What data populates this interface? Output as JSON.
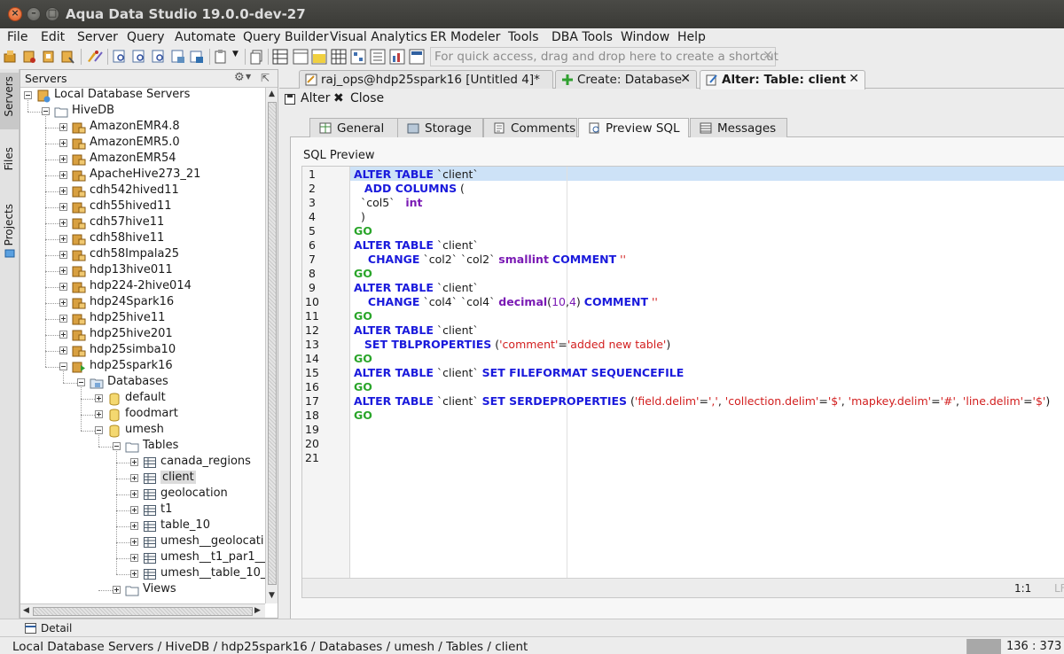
{
  "window": {
    "title": "Aqua Data Studio 19.0.0-dev-27"
  },
  "menu": [
    "File",
    "Edit",
    "Server",
    "Query",
    "Automate",
    "Query Builder",
    "Visual Analytics",
    "ER Modeler",
    "Tools",
    "DBA Tools",
    "Window",
    "Help"
  ],
  "toolbar": {
    "quick_access_placeholder": "For quick access, drag and drop here to create a shortcut"
  },
  "side_tabs": [
    "Servers",
    "Files",
    "Projects"
  ],
  "servers_panel": {
    "title": "Servers",
    "tree": [
      {
        "label": "Local Database Servers",
        "level": 0,
        "icon": "server-group-icon",
        "expander": "minus"
      },
      {
        "label": "HiveDB",
        "level": 1,
        "icon": "folder-icon",
        "expander": "minus"
      },
      {
        "label": "AmazonEMR4.8",
        "level": 2,
        "icon": "database-server-icon",
        "expander": "plus"
      },
      {
        "label": "AmazonEMR5.0",
        "level": 2,
        "icon": "database-server-icon",
        "expander": "plus"
      },
      {
        "label": "AmazonEMR54",
        "level": 2,
        "icon": "database-server-icon",
        "expander": "plus"
      },
      {
        "label": "ApacheHive273_21",
        "level": 2,
        "icon": "database-server-icon",
        "expander": "plus"
      },
      {
        "label": "cdh542hived11",
        "level": 2,
        "icon": "database-server-icon",
        "expander": "plus"
      },
      {
        "label": "cdh55hived11",
        "level": 2,
        "icon": "database-server-icon",
        "expander": "plus"
      },
      {
        "label": "cdh57hive11",
        "level": 2,
        "icon": "database-server-icon",
        "expander": "plus"
      },
      {
        "label": "cdh58hive11",
        "level": 2,
        "icon": "database-server-icon",
        "expander": "plus"
      },
      {
        "label": "cdh58Impala25",
        "level": 2,
        "icon": "database-server-icon",
        "expander": "plus"
      },
      {
        "label": "hdp13hive011",
        "level": 2,
        "icon": "database-server-icon",
        "expander": "plus"
      },
      {
        "label": "hdp224-2hive014",
        "level": 2,
        "icon": "database-server-icon",
        "expander": "plus"
      },
      {
        "label": "hdp24Spark16",
        "level": 2,
        "icon": "database-server-icon",
        "expander": "plus"
      },
      {
        "label": "hdp25hive11",
        "level": 2,
        "icon": "database-server-icon",
        "expander": "plus"
      },
      {
        "label": "hdp25hive201",
        "level": 2,
        "icon": "database-server-icon",
        "expander": "plus"
      },
      {
        "label": "hdp25simba10",
        "level": 2,
        "icon": "database-server-icon",
        "expander": "plus"
      },
      {
        "label": "hdp25spark16",
        "level": 2,
        "icon": "database-server-connected-icon",
        "expander": "minus"
      },
      {
        "label": "Databases",
        "level": 3,
        "icon": "databases-folder-icon",
        "expander": "minus"
      },
      {
        "label": "default",
        "level": 4,
        "icon": "database-icon",
        "expander": "plus"
      },
      {
        "label": "foodmart",
        "level": 4,
        "icon": "database-icon",
        "expander": "plus"
      },
      {
        "label": "umesh",
        "level": 4,
        "icon": "database-icon",
        "expander": "minus"
      },
      {
        "label": "Tables",
        "level": 5,
        "icon": "folder-icon",
        "expander": "minus"
      },
      {
        "label": "canada_regions",
        "level": 6,
        "icon": "table-icon",
        "expander": "plus"
      },
      {
        "label": "client",
        "level": 6,
        "icon": "table-icon",
        "expander": "plus",
        "selected": true
      },
      {
        "label": "geolocation",
        "level": 6,
        "icon": "table-icon",
        "expander": "plus"
      },
      {
        "label": "t1",
        "level": 6,
        "icon": "table-icon",
        "expander": "plus"
      },
      {
        "label": "table_10",
        "level": 6,
        "icon": "table-icon",
        "expander": "plus"
      },
      {
        "label": "umesh__geolocati",
        "level": 6,
        "icon": "table-icon",
        "expander": "plus"
      },
      {
        "label": "umesh__t1_par1__",
        "level": 6,
        "icon": "table-icon",
        "expander": "plus"
      },
      {
        "label": "umesh__table_10_",
        "level": 6,
        "icon": "table-icon",
        "expander": "plus"
      },
      {
        "label": "Views",
        "level": 5,
        "icon": "folder-icon",
        "expander": "plus"
      }
    ]
  },
  "doc_tabs": [
    {
      "label": "raj_ops@hdp25spark16 [Untitled 4]*",
      "active": false
    },
    {
      "label": "Create: Database",
      "active": false
    },
    {
      "label": "Alter: Table: client",
      "active": true
    }
  ],
  "actions": {
    "alter": "Alter",
    "close": "Close"
  },
  "inner_tabs": [
    {
      "label": "General",
      "active": false
    },
    {
      "label": "Storage",
      "active": false
    },
    {
      "label": "Comments",
      "active": false
    },
    {
      "label": "Preview SQL",
      "active": true
    },
    {
      "label": "Messages",
      "active": false
    }
  ],
  "sql_preview": {
    "label": "SQL Preview",
    "line_count": 21,
    "lines": [
      [
        [
          "kw",
          "ALTER TABLE"
        ],
        [
          "t",
          " `client`"
        ]
      ],
      [
        [
          "t",
          "   "
        ],
        [
          "kw",
          "ADD COLUMNS"
        ],
        [
          "t",
          " ("
        ]
      ],
      [
        [
          "t",
          "  `col5`   "
        ],
        [
          "ty",
          "int"
        ]
      ],
      [
        [
          "t",
          "  )"
        ]
      ],
      [
        [
          "go",
          "GO"
        ]
      ],
      [
        [
          "kw",
          "ALTER TABLE"
        ],
        [
          "t",
          " `client`"
        ]
      ],
      [
        [
          "t",
          "    "
        ],
        [
          "kw",
          "CHANGE"
        ],
        [
          "t",
          " `col2` `col2` "
        ],
        [
          "ty",
          "smallint"
        ],
        [
          "t",
          " "
        ],
        [
          "kw",
          "COMMENT"
        ],
        [
          "str",
          " ''"
        ]
      ],
      [
        [
          "go",
          "GO"
        ]
      ],
      [
        [
          "kw",
          "ALTER TABLE"
        ],
        [
          "t",
          " `client`"
        ]
      ],
      [
        [
          "t",
          "    "
        ],
        [
          "kw",
          "CHANGE"
        ],
        [
          "t",
          " `col4` `col4` "
        ],
        [
          "ty",
          "decimal"
        ],
        [
          "t",
          "("
        ],
        [
          "num",
          "10"
        ],
        [
          "t",
          ","
        ],
        [
          "num",
          "4"
        ],
        [
          "t",
          ") "
        ],
        [
          "kw",
          "COMMENT"
        ],
        [
          "str",
          " ''"
        ]
      ],
      [
        [
          "go",
          "GO"
        ]
      ],
      [
        [
          "kw",
          "ALTER TABLE"
        ],
        [
          "t",
          " `client`"
        ]
      ],
      [
        [
          "t",
          "   "
        ],
        [
          "kw",
          "SET TBLPROPERTIES"
        ],
        [
          "t",
          " ("
        ],
        [
          "str",
          "'comment'"
        ],
        [
          "t",
          "="
        ],
        [
          "str",
          "'added new table'"
        ],
        [
          "t",
          ")"
        ]
      ],
      [
        [
          "go",
          "GO"
        ]
      ],
      [
        [
          "kw",
          "ALTER TABLE"
        ],
        [
          "t",
          " `client` "
        ],
        [
          "kw",
          "SET FILEFORMAT SEQUENCEFILE"
        ]
      ],
      [
        [
          "go",
          "GO"
        ]
      ],
      [
        [
          "kw",
          "ALTER TABLE"
        ],
        [
          "t",
          " `client` "
        ],
        [
          "kw",
          "SET SERDEPROPERTIES"
        ],
        [
          "t",
          " ("
        ],
        [
          "str",
          "'field.delim'"
        ],
        [
          "t",
          "="
        ],
        [
          "str",
          "','"
        ],
        [
          "t",
          ", "
        ],
        [
          "str",
          "'collection.delim'"
        ],
        [
          "t",
          "="
        ],
        [
          "str",
          "'$'"
        ],
        [
          "t",
          ", "
        ],
        [
          "str",
          "'mapkey.delim'"
        ],
        [
          "t",
          "="
        ],
        [
          "str",
          "'#'"
        ],
        [
          "t",
          ", "
        ],
        [
          "str",
          "'line.delim'"
        ],
        [
          "t",
          "="
        ],
        [
          "str",
          "'$'"
        ],
        [
          "t",
          ")"
        ]
      ],
      [
        [
          "go",
          "GO"
        ]
      ],
      [],
      [],
      []
    ],
    "cursor": "1:1",
    "eol": "LF"
  },
  "detail": {
    "label": "Detail"
  },
  "status": {
    "path": "Local Database Servers / HiveDB / hdp25spark16 / Databases / umesh / Tables / client",
    "memory": "136 : 373 :"
  },
  "colors": {
    "keyword": "#1a1adc",
    "go": "#2aa52a",
    "type": "#7a1ab4",
    "string": "#d21e1e",
    "highlight": "#cde2f7"
  }
}
